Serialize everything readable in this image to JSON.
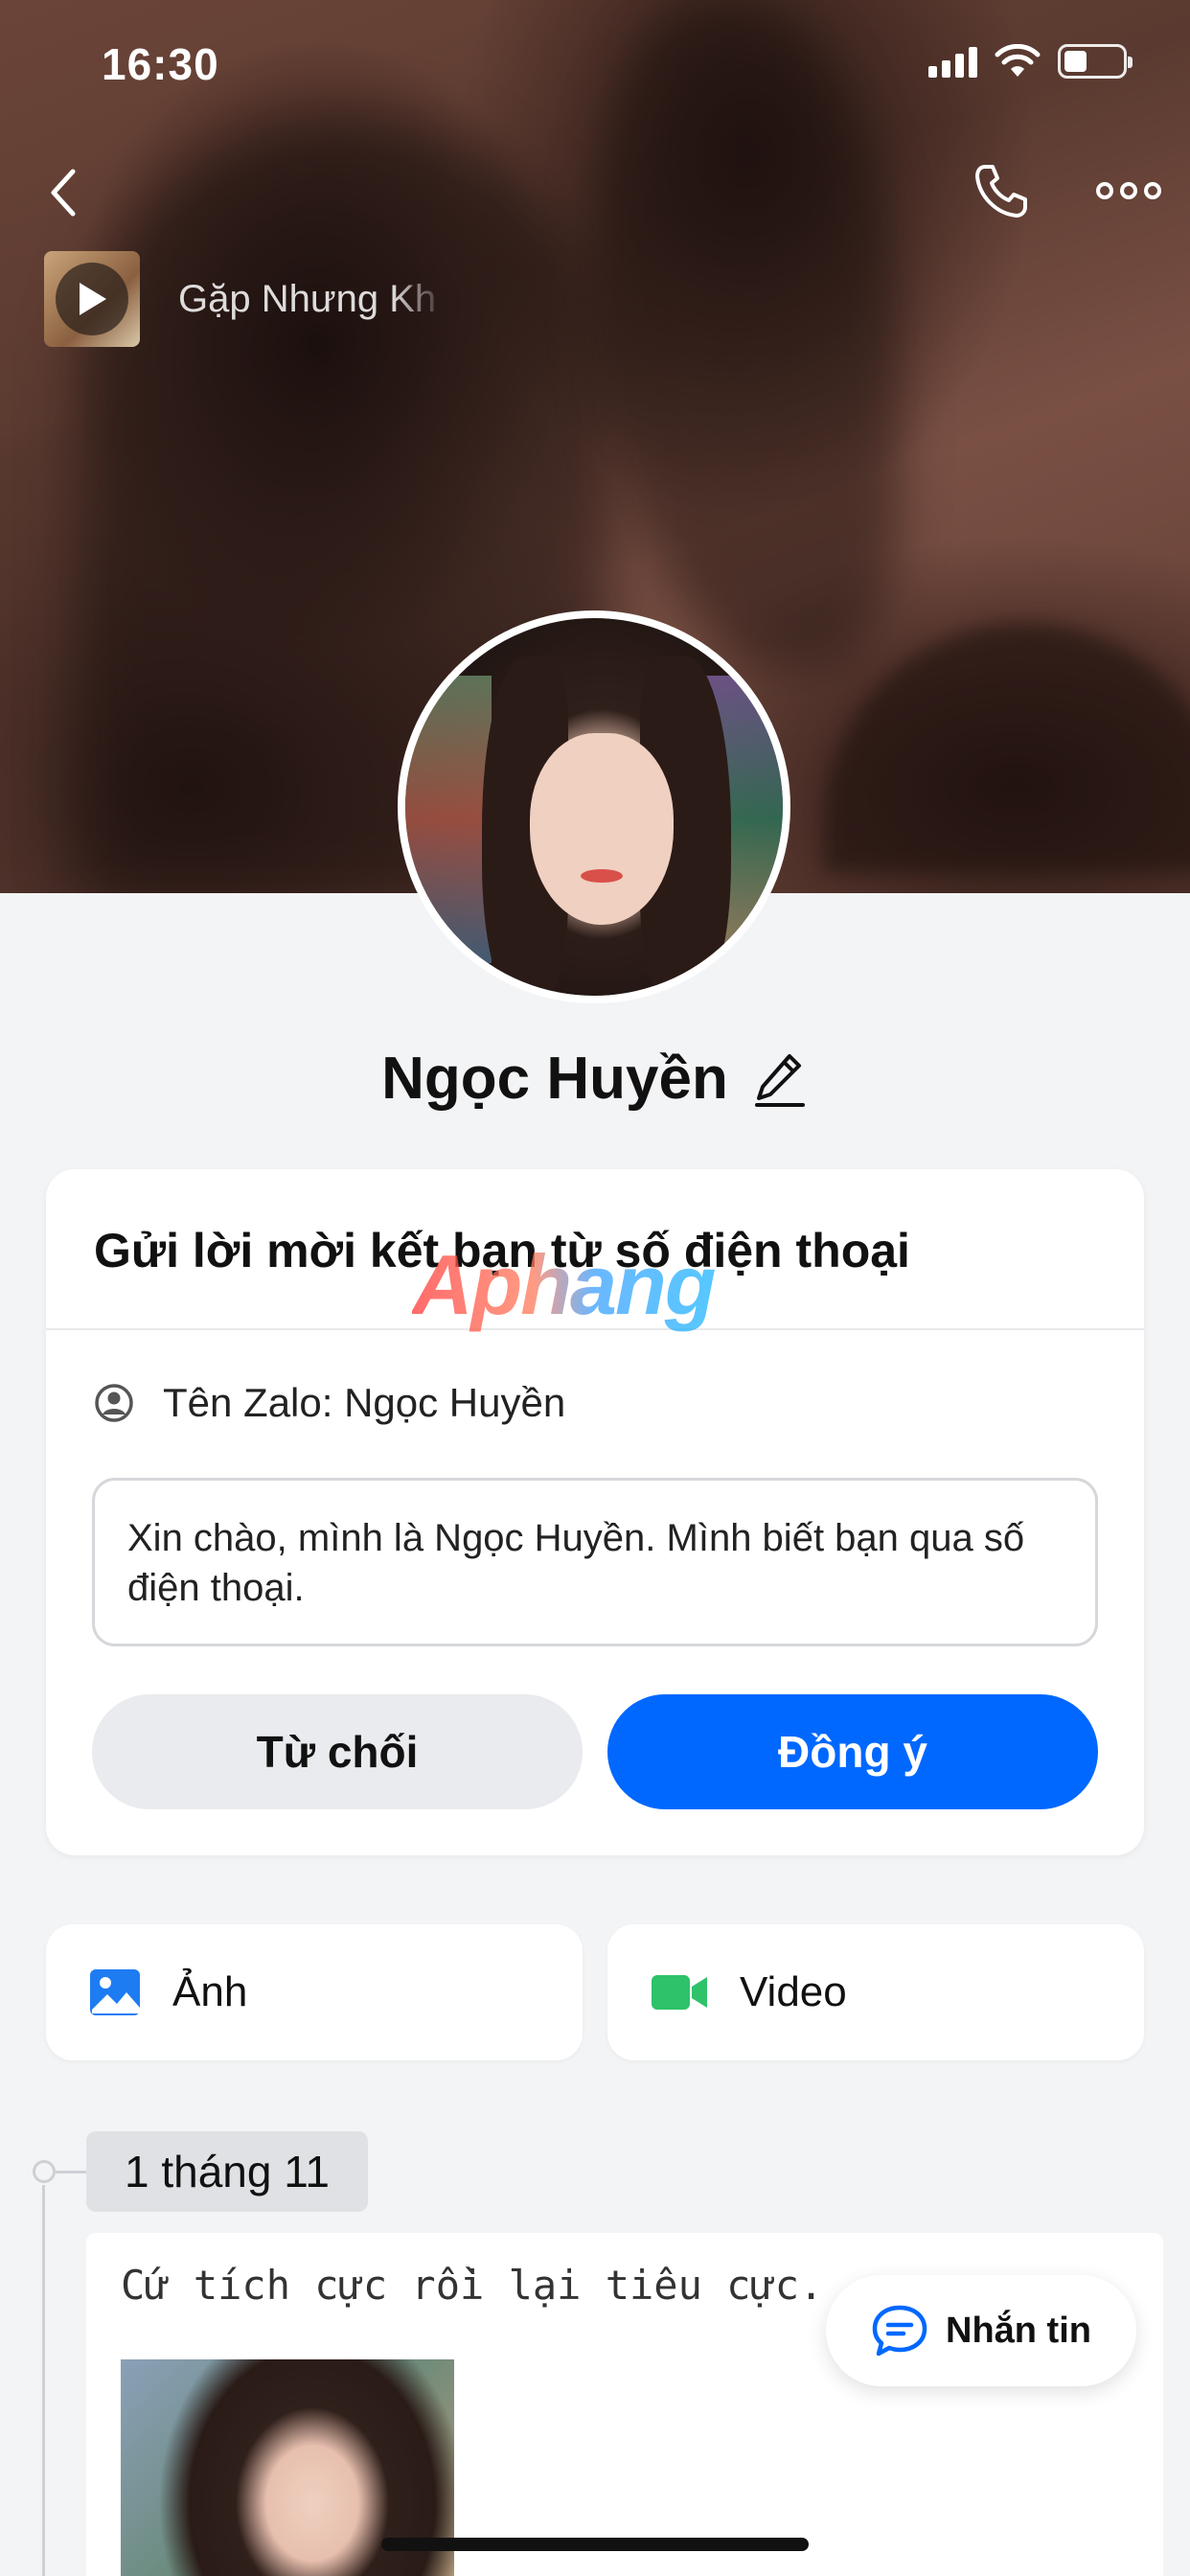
{
  "status_bar": {
    "time": "16:30",
    "battery_level": 0.4
  },
  "header": {
    "icons": [
      "back-chevron-icon",
      "phone-icon",
      "more-dots-icon"
    ],
    "music": {
      "song_title": "Gặp Nhưng Kh"
    }
  },
  "profile": {
    "name": "Ngọc Huyền"
  },
  "friend_request": {
    "title": "Gửi lời mời kết bạn từ số điện thoại",
    "zalo_name_label": "Tên Zalo: Ngọc Huyền",
    "message": "Xin chào, mình là Ngọc Huyền. Mình biết bạn qua số điện thoại.",
    "decline_label": "Từ chối",
    "accept_label": "Đồng ý"
  },
  "watermark": {
    "text": "Aphang"
  },
  "media_tabs": {
    "photo_label": "Ảnh",
    "video_label": "Video"
  },
  "timeline": {
    "date": "1 tháng 11",
    "post_text": "Cứ tích cực rồi lại tiêu cực."
  },
  "chat_button": {
    "label": "Nhắn tin"
  },
  "colors": {
    "primary": "#0068ff",
    "video_green": "#2ec26a",
    "photo_blue": "#1e7cf2",
    "background": "#f3f4f6"
  }
}
